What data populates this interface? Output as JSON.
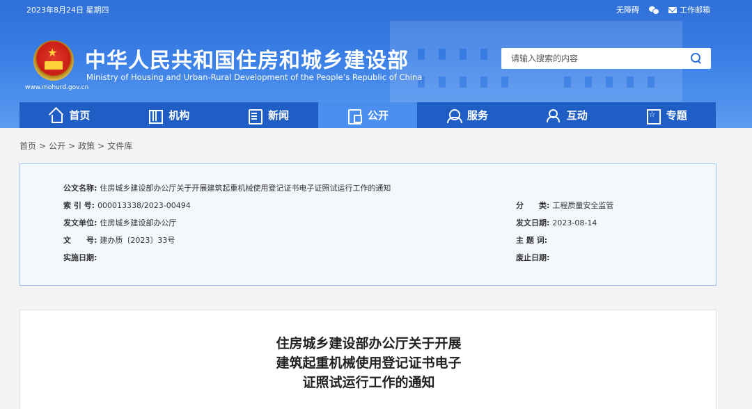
{
  "topbar": {
    "date": "2023年8月24日 星期四",
    "accessibility": "无障碍",
    "wechat_icon": "wechat-icon",
    "mail_icon": "mail-icon",
    "work_mail": "工作邮箱"
  },
  "header": {
    "site_url": "www.mohurd.gov.cn",
    "title_cn": "中华人民共和国住房和城乡建设部",
    "title_en": "Ministry of Housing and Urban-Rural Development of the People’s Republic of China",
    "search_placeholder": "请输入搜索的内容"
  },
  "nav": {
    "items": [
      {
        "label": "首页",
        "icon": "home-icon"
      },
      {
        "label": "机构",
        "icon": "organization-icon"
      },
      {
        "label": "新闻",
        "icon": "news-icon"
      },
      {
        "label": "公开",
        "icon": "disclosure-icon",
        "active": true
      },
      {
        "label": "服务",
        "icon": "service-icon"
      },
      {
        "label": "互动",
        "icon": "interaction-icon"
      },
      {
        "label": "专题",
        "icon": "topic-icon"
      }
    ]
  },
  "breadcrumb": [
    "首页",
    "公开",
    "政策",
    "文件库"
  ],
  "meta": {
    "doc_name_label": "公文名称:",
    "doc_name": "住房城乡建设部办公厅关于开展建筑起重机械使用登记证书电子证照试运行工作的通知",
    "index_label": "索 引 号:",
    "index": "000013338/2023-00494",
    "category_label": "分　　类:",
    "category": "工程质量安全监管",
    "issuer_label": "发文单位:",
    "issuer": "住房城乡建设部办公厅",
    "issue_date_label": "发文日期:",
    "issue_date": "2023-08-14",
    "doc_no_label": "文　　号:",
    "doc_no": "建办质〔2023〕33号",
    "keywords_label": "主 题 词:",
    "keywords": "",
    "effective_label": "实施日期:",
    "effective": "",
    "expiry_label": "废止日期:",
    "expiry": ""
  },
  "article": {
    "title_lines": [
      "住房城乡建设部办公厅关于开展",
      "建筑起重机械使用登记证书电子",
      "证照试运行工作的通知"
    ]
  },
  "colors": {
    "header_blue": "#2f6fd8",
    "nav_blue": "#1f5fc5",
    "nav_active": "#4a8ff0",
    "meta_border": "#9ec3ee"
  }
}
